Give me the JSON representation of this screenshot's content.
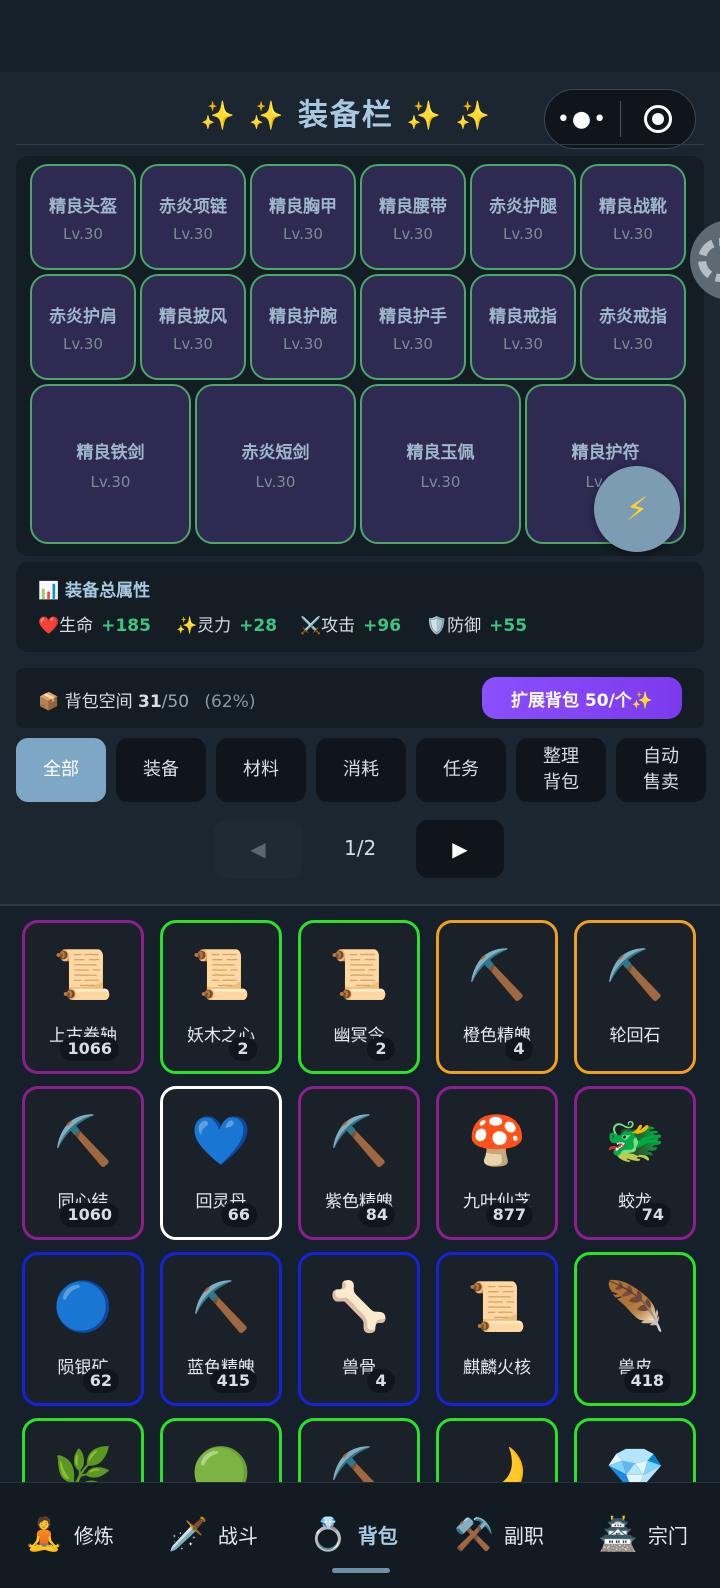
{
  "header": {
    "title": "装备栏",
    "title_decor": "✨ ✨",
    "title_decor_right": "✨ ✨",
    "more_icon": "•●•"
  },
  "equipment": [
    {
      "name": "精良头盔",
      "level": "Lv.30"
    },
    {
      "name": "赤炎项链",
      "level": "Lv.30"
    },
    {
      "name": "精良胸甲",
      "level": "Lv.30"
    },
    {
      "name": "精良腰带",
      "level": "Lv.30"
    },
    {
      "name": "赤炎护腿",
      "level": "Lv.30"
    },
    {
      "name": "精良战靴",
      "level": "Lv.30"
    },
    {
      "name": "赤炎护肩",
      "level": "Lv.30"
    },
    {
      "name": "精良披风",
      "level": "Lv.30"
    },
    {
      "name": "精良护腕",
      "level": "Lv.30"
    },
    {
      "name": "精良护手",
      "level": "Lv.30"
    },
    {
      "name": "精良戒指",
      "level": "Lv.30"
    },
    {
      "name": "赤炎戒指",
      "level": "Lv.30"
    },
    {
      "name": "精良铁剑",
      "level": "Lv.30"
    },
    {
      "name": "赤炎短剑",
      "level": "Lv.30"
    },
    {
      "name": "精良玉佩",
      "level": "Lv.30"
    },
    {
      "name": "精良护符",
      "level": "Lv.30"
    }
  ],
  "stats": {
    "title": "装备总属性",
    "title_icon": "📊",
    "items": [
      {
        "icon": "❤️",
        "label": "生命",
        "value": "+185"
      },
      {
        "icon": "✨",
        "label": "灵力",
        "value": "+28"
      },
      {
        "icon": "⚔️",
        "label": "攻击",
        "value": "+96"
      },
      {
        "icon": "🛡️",
        "label": "防御",
        "value": "+55"
      }
    ]
  },
  "bag": {
    "icon": "📦",
    "label": "背包空间",
    "used": "31",
    "total": "/50",
    "percent": "(62%)",
    "expand_label": "扩展背包 50/个✨"
  },
  "categories": [
    "全部",
    "装备",
    "材料",
    "消耗",
    "任务",
    "整理\n背包",
    "自动\n售卖"
  ],
  "active_category": "全部",
  "pager": {
    "prev": "◀",
    "next": "▶",
    "text": "1/2"
  },
  "rarity_colors": {
    "purple": "#8b1f8f",
    "green": "#2be02b",
    "orange": "#f0a020",
    "white": "#ffffff",
    "blue": "#1522d8"
  },
  "items": [
    {
      "icon": "📜",
      "name": "上古卷轴",
      "count": "1066",
      "rarity": "purple"
    },
    {
      "icon": "📜",
      "name": "妖木之心",
      "count": "2",
      "rarity": "green"
    },
    {
      "icon": "📜",
      "name": "幽冥令",
      "count": "2",
      "rarity": "green"
    },
    {
      "icon": "⛏️",
      "name": "橙色精魄",
      "count": "4",
      "rarity": "orange"
    },
    {
      "icon": "⛏️",
      "name": "轮回石",
      "count": "",
      "rarity": "orange"
    },
    {
      "icon": "⛏️",
      "name": "同心结",
      "count": "1060",
      "rarity": "purple"
    },
    {
      "icon": "💙",
      "name": "回灵丹",
      "count": "66",
      "rarity": "white"
    },
    {
      "icon": "⛏️",
      "name": "紫色精魄",
      "count": "84",
      "rarity": "purple"
    },
    {
      "icon": "🍄",
      "name": "九叶仙芝",
      "count": "877",
      "rarity": "purple"
    },
    {
      "icon": "🐲",
      "name": "蛟龙",
      "count": "74",
      "rarity": "purple"
    },
    {
      "icon": "🔵",
      "name": "陨银矿",
      "count": "62",
      "rarity": "blue"
    },
    {
      "icon": "⛏️",
      "name": "蓝色精魄",
      "count": "415",
      "rarity": "blue"
    },
    {
      "icon": "🦴",
      "name": "兽骨",
      "count": "4",
      "rarity": "blue"
    },
    {
      "icon": "📜",
      "name": "麒麟火核",
      "count": "",
      "rarity": "blue"
    },
    {
      "icon": "🪶",
      "name": "兽皮",
      "count": "418",
      "rarity": "green"
    },
    {
      "icon": "🌿",
      "name": "",
      "count": "",
      "rarity": "green"
    },
    {
      "icon": "🟢",
      "name": "",
      "count": "",
      "rarity": "green"
    },
    {
      "icon": "⛏️",
      "name": "",
      "count": "",
      "rarity": "green"
    },
    {
      "icon": "🌙",
      "name": "",
      "count": "",
      "rarity": "green"
    },
    {
      "icon": "💎",
      "name": "",
      "count": "",
      "rarity": "green"
    }
  ],
  "nav": [
    {
      "icon": "🧘",
      "label": "修炼"
    },
    {
      "icon": "🗡️",
      "label": "战斗"
    },
    {
      "icon": "💍",
      "label": "背包"
    },
    {
      "icon": "⚒️",
      "label": "副职"
    },
    {
      "icon": "🏯",
      "label": "宗门"
    }
  ],
  "active_nav": "背包",
  "quick_action_icon": "⚡"
}
